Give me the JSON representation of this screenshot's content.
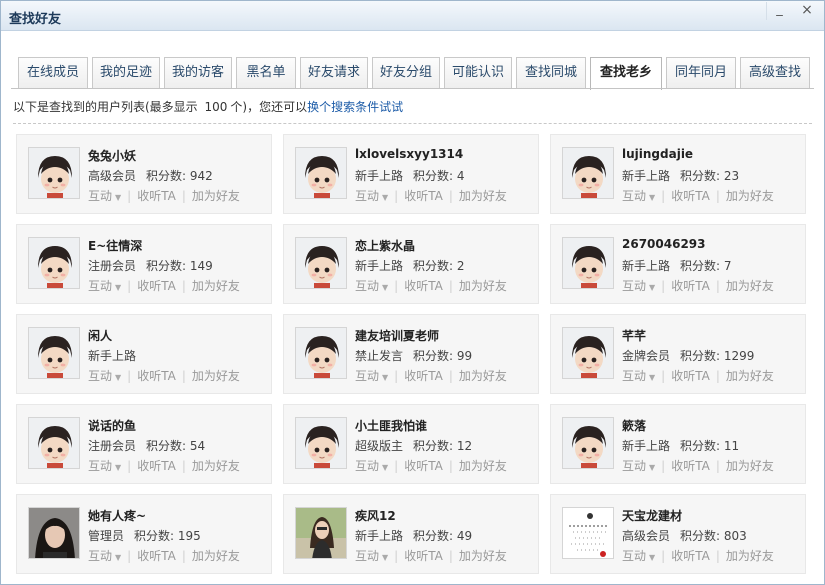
{
  "window": {
    "title": "查找好友",
    "minimize_glyph": "_",
    "close_glyph": "×"
  },
  "tabs": [
    {
      "label": "在线成员",
      "active": false
    },
    {
      "label": "我的足迹",
      "active": false
    },
    {
      "label": "我的访客",
      "active": false
    },
    {
      "label": "黑名单",
      "active": false
    },
    {
      "label": "好友请求",
      "active": false
    },
    {
      "label": "好友分组",
      "active": false
    },
    {
      "label": "可能认识",
      "active": false
    },
    {
      "label": "查找同城",
      "active": false
    },
    {
      "label": "查找老乡",
      "active": true
    },
    {
      "label": "同年同月",
      "active": false
    },
    {
      "label": "高级查找",
      "active": false
    }
  ],
  "info": {
    "prefix": "以下是查找到的用户列表(最多显示",
    "count": "100",
    "mid": "个)，您还可以",
    "link": "换个搜索条件试试"
  },
  "actions": {
    "interact": "互动",
    "listen": "收听TA",
    "add_friend": "加为好友",
    "caret": "▼"
  },
  "score_label": "积分数: ",
  "users": [
    {
      "name": "兔兔小妖",
      "level": "高级会员",
      "score": "942",
      "avatar": "cartoon-avatar"
    },
    {
      "name": "lxlovelsxyy1314",
      "level": "新手上路",
      "score": "4",
      "avatar": "cartoon-avatar"
    },
    {
      "name": "lujingdajie",
      "level": "新手上路",
      "score": "23",
      "avatar": "cartoon-avatar"
    },
    {
      "name": "E~往情深",
      "level": "注册会员",
      "score": "149",
      "avatar": "cartoon-avatar"
    },
    {
      "name": "恋上紫水晶",
      "level": "新手上路",
      "score": "2",
      "avatar": "cartoon-avatar"
    },
    {
      "name": "2670046293",
      "level": "新手上路",
      "score": "7",
      "avatar": "cartoon-avatar"
    },
    {
      "name": "闲人",
      "level": "新手上路",
      "score": null,
      "avatar": "cartoon-avatar"
    },
    {
      "name": "建友培训夏老师",
      "level": "禁止发言",
      "score": "99",
      "avatar": "cartoon-avatar"
    },
    {
      "name": "芊芊",
      "level": "金牌会员",
      "score": "1299",
      "avatar": "cartoon-avatar"
    },
    {
      "name": "说话的鱼",
      "level": "注册会员",
      "score": "54",
      "avatar": "cartoon-avatar"
    },
    {
      "name": "小土匪我怕谁",
      "level": "超级版主",
      "score": "12",
      "avatar": "cartoon-avatar"
    },
    {
      "name": "簌落",
      "level": "新手上路",
      "score": "11",
      "avatar": "cartoon-avatar"
    },
    {
      "name": "她有人疼~",
      "level": "管理员",
      "score": "195",
      "avatar": "photo-portrait"
    },
    {
      "name": "疾风12",
      "level": "新手上路",
      "score": "49",
      "avatar": "photo-portrait-light"
    },
    {
      "name": "天宝龙建材",
      "level": "高级会员",
      "score": "803",
      "avatar": "logo-image"
    }
  ]
}
